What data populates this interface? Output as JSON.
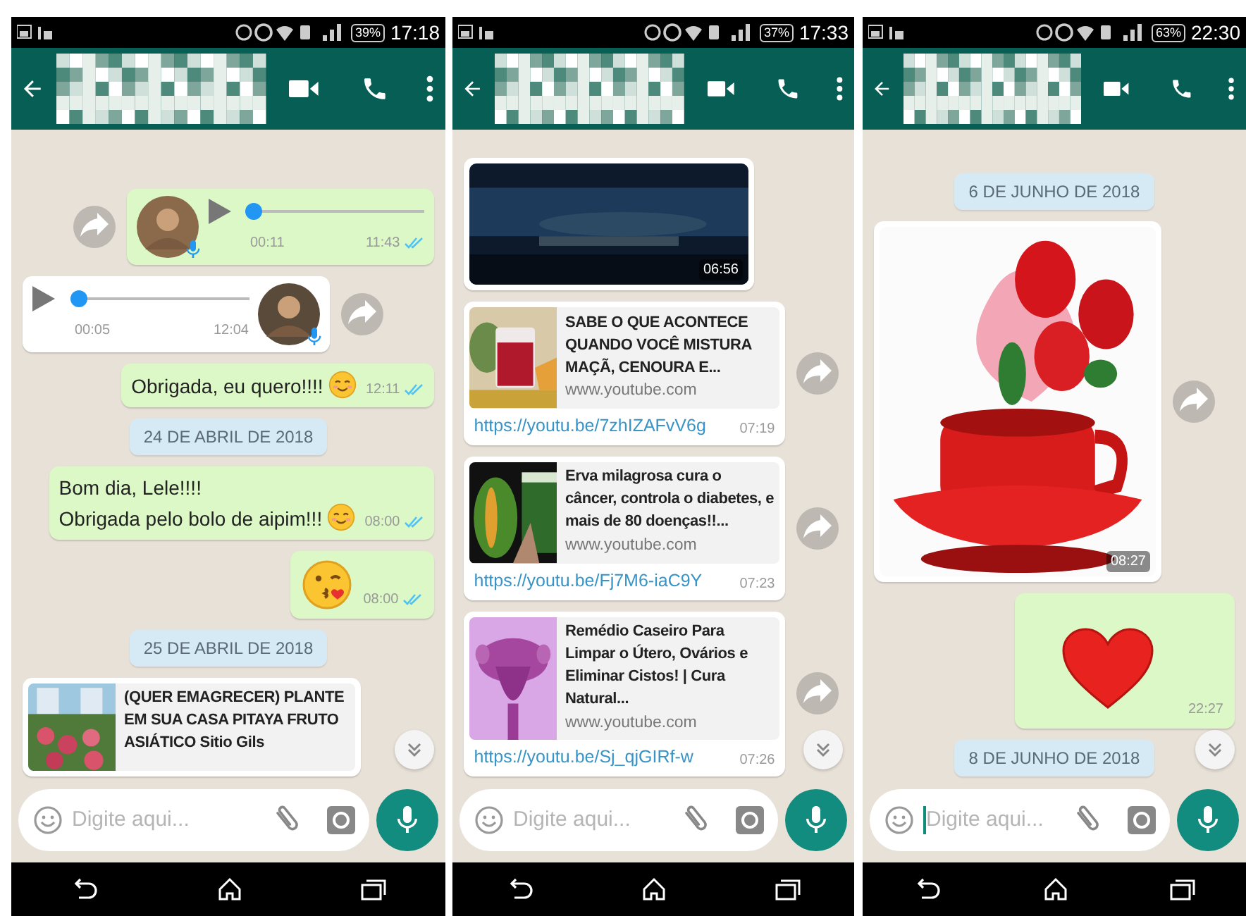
{
  "phones": [
    {
      "status_bar": {
        "battery": "39%",
        "time": "17:18"
      },
      "messages": [
        {
          "kind": "voice",
          "outgoing": true,
          "duration": "00:11",
          "time": "11:43",
          "read": true,
          "forward": true,
          "level": 0
        },
        {
          "kind": "voice",
          "outgoing": false,
          "duration": "00:05",
          "time": "12:04",
          "read": false,
          "forward": true,
          "level": 0
        },
        {
          "kind": "text",
          "outgoing": true,
          "text": "Obrigada, eu quero!!!!",
          "emoji": {
            "kind": "smile"
          },
          "time": "12:11",
          "read": true,
          "forward": false
        },
        {
          "kind": "date",
          "label": "24 DE ABRIL DE 2018"
        },
        {
          "kind": "text",
          "outgoing": true,
          "text": "Bom dia, Lele!!!!\nObrigada pelo bolo de aipim!!!",
          "emoji": {
            "kind": "smile"
          },
          "time": "08:00",
          "read": true,
          "forward": false
        },
        {
          "kind": "emoji",
          "outgoing": true,
          "emoji": {
            "kind": "kiss"
          },
          "time": "08:00",
          "read": true,
          "forward": false
        },
        {
          "kind": "date",
          "label": "25 DE ABRIL DE 2018"
        },
        {
          "kind": "link",
          "outgoing": false,
          "title": "(QUER EMAGRECER) PLANTE EM SUA CASA PITAYA FRUTO ASIÁTICO Sitio Gils",
          "forward": false,
          "read": false
        }
      ],
      "input": {
        "placeholder": "Digite aqui...",
        "focused": false
      }
    },
    {
      "status_bar": {
        "battery": "37%",
        "time": "17:33"
      },
      "messages": [
        {
          "kind": "video",
          "outgoing": false,
          "time": "06:56",
          "forward": false,
          "read": false
        },
        {
          "kind": "link",
          "outgoing": false,
          "title": "SABE O QUE ACONTECE QUANDO VOCÊ MISTURA MAÇÃ, CENOURA E...",
          "domain": "www.youtube.com",
          "url": "https://youtu.be/7zhIZAFvV6g",
          "time": "07:19",
          "forward": true,
          "read": false
        },
        {
          "kind": "link",
          "outgoing": false,
          "title": "Erva milagrosa cura o câncer, controla o diabetes, e mais de 80 doenças!!...",
          "domain": "www.youtube.com",
          "url": "https://youtu.be/Fj7M6-iaC9Y",
          "time": "07:23",
          "forward": true,
          "read": false
        },
        {
          "kind": "link",
          "outgoing": false,
          "title": "Remédio Caseiro Para Limpar o Útero, Ovários e Eliminar Cistos! | Cura Natural...",
          "domain": "www.youtube.com",
          "url": "https://youtu.be/Sj_qjGIRf-w",
          "time": "07:26",
          "forward": true,
          "read": false
        }
      ],
      "input": {
        "placeholder": "Digite aqui...",
        "focused": false
      }
    },
    {
      "status_bar": {
        "battery": "63%",
        "time": "22:30"
      },
      "messages": [
        {
          "kind": "date",
          "label": "6 DE JUNHO DE 2018"
        },
        {
          "outgoing": false,
          "time": "08:27",
          "forward": true,
          "read": false
        },
        {
          "kind": "emoji",
          "outgoing": true,
          "emoji": {
            "kind": "heart"
          },
          "time": "22:27",
          "read": false,
          "forward": false
        },
        {
          "kind": "date",
          "label": "8 DE JUNHO DE 2018"
        }
      ],
      "input": {
        "placeholder": "Digite aqui...",
        "focused": true
      }
    }
  ]
}
